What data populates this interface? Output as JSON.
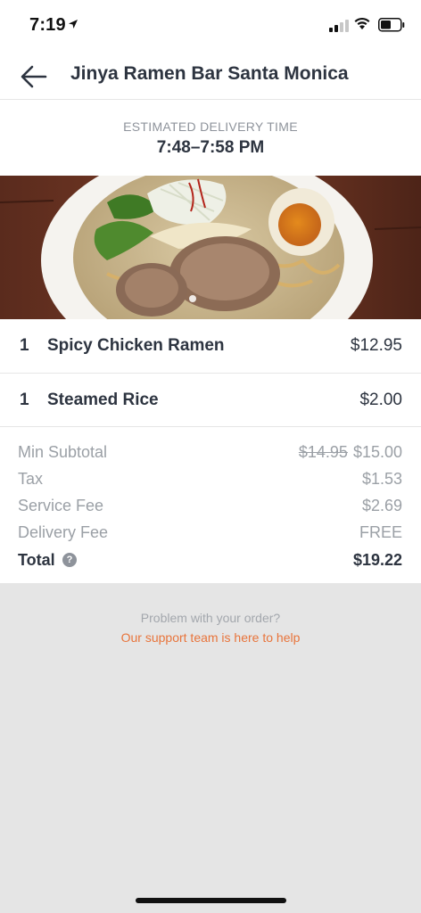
{
  "status_bar": {
    "time": "7:19"
  },
  "header": {
    "title": "Jinya Ramen Bar Santa Monica"
  },
  "eta": {
    "label": "ESTIMATED DELIVERY TIME",
    "time": "7:48–7:58 PM"
  },
  "items": [
    {
      "qty": "1",
      "name": "Spicy Chicken Ramen",
      "price": "$12.95"
    },
    {
      "qty": "1",
      "name": "Steamed Rice",
      "price": "$2.00"
    }
  ],
  "totals": {
    "min_subtotal": {
      "label": "Min Subtotal",
      "original": "$14.95",
      "value": "$15.00"
    },
    "tax": {
      "label": "Tax",
      "value": "$1.53"
    },
    "service_fee": {
      "label": "Service Fee",
      "value": "$2.69"
    },
    "delivery_fee": {
      "label": "Delivery Fee",
      "value": "FREE"
    },
    "total": {
      "label": "Total",
      "value": "$19.22"
    }
  },
  "support": {
    "question": "Problem with your order?",
    "link": "Our support team is here to help"
  },
  "colors": {
    "accent": "#e8743b",
    "text": "#2d3440",
    "muted": "#9ba0a6",
    "background": "#e5e5e5"
  }
}
